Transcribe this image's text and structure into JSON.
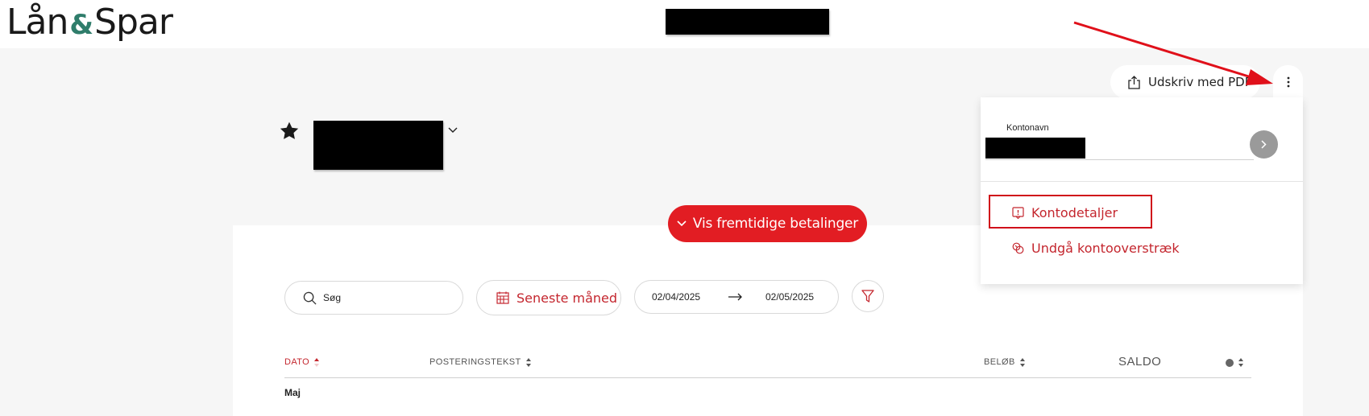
{
  "header": {
    "logo_left": "Lån",
    "logo_amp": "&",
    "logo_right": "Spar"
  },
  "toolbar": {
    "print_pdf_label": "Udskriv med PDF"
  },
  "account_menu": {
    "account_name_label": "Kontonavn",
    "items": [
      {
        "label": "Kontodetaljer",
        "icon": "info-icon"
      },
      {
        "label": "Undgå kontooverstræk",
        "icon": "overdraft-icon"
      }
    ]
  },
  "future_payments": {
    "label": "Vis fremtidige betalinger"
  },
  "filters": {
    "search_placeholder": "Søg",
    "period_label": "Seneste måned",
    "date_from": "02/04/2025",
    "date_to": "02/05/2025"
  },
  "table": {
    "columns": [
      "DATO",
      "POSTERINGSTEKST",
      "BELØB",
      "SALDO"
    ],
    "groups": [
      {
        "month": "Maj"
      }
    ]
  },
  "colors": {
    "brand_red": "#e21d23",
    "text_red": "#c4262e",
    "logo_green": "#2f7d6b"
  }
}
